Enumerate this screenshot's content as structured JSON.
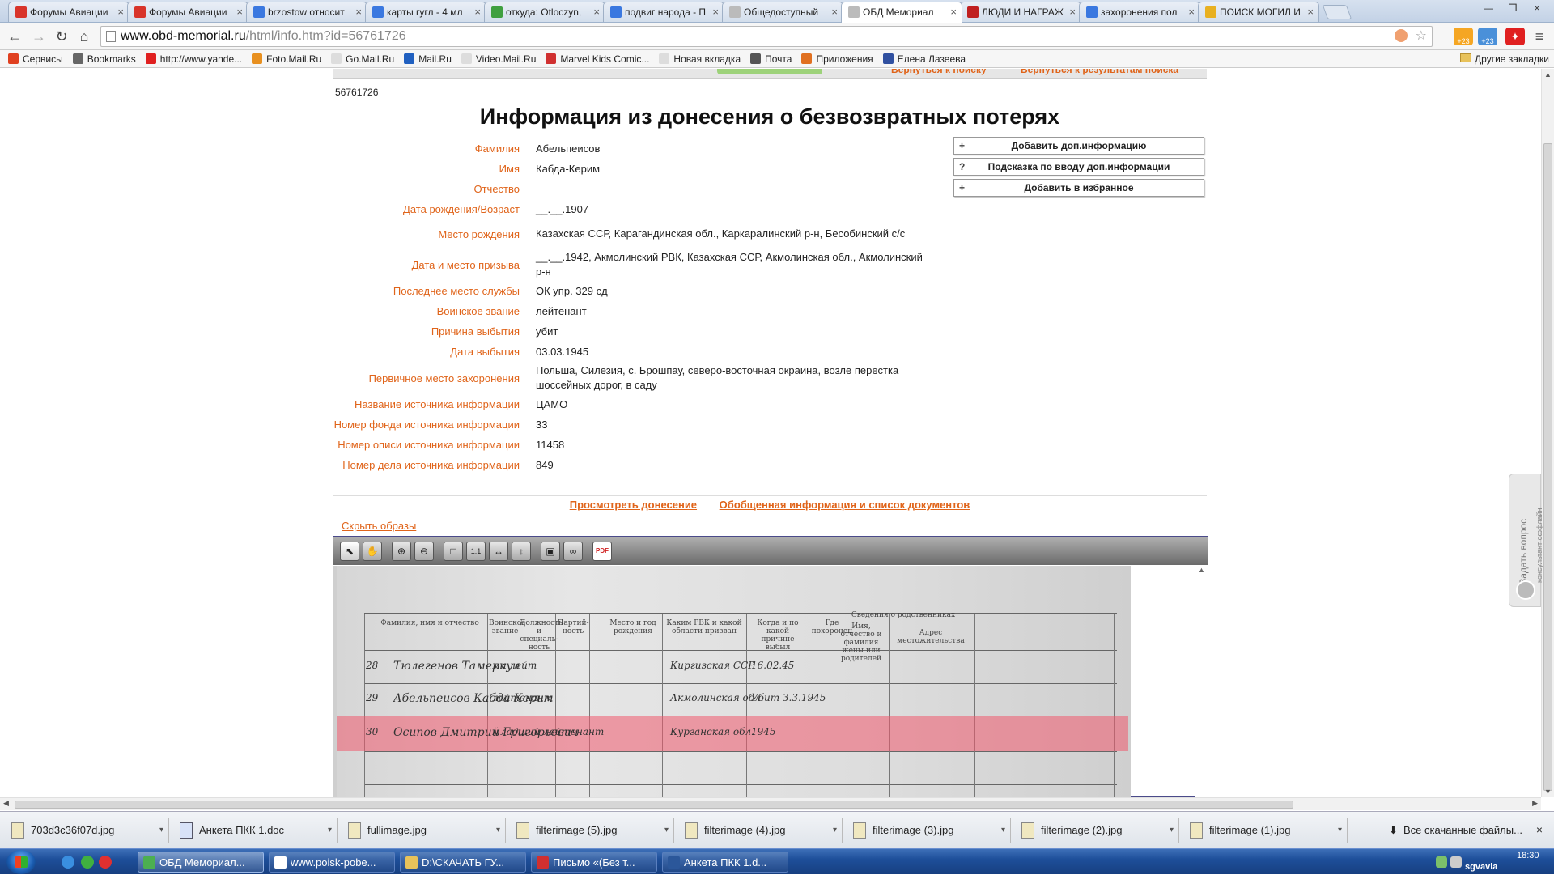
{
  "browser": {
    "tabs": [
      {
        "title": "Форумы Авиации",
        "color": "#d8342a",
        "active": false
      },
      {
        "title": "Форумы Авиации",
        "color": "#d8342a",
        "active": false
      },
      {
        "title": "brzostow относит",
        "color": "#3a78e0",
        "active": false
      },
      {
        "title": "карты гугл - 4 мл",
        "color": "#3a78e0",
        "active": false
      },
      {
        "title": "откуда: Otloczyn,",
        "color": "#40a040",
        "active": false
      },
      {
        "title": "подвиг народа - П",
        "color": "#3a78e0",
        "active": false
      },
      {
        "title": "Общедоступный",
        "color": "#bbbbbb",
        "active": false
      },
      {
        "title": "ОБД Мемориал",
        "color": "#bbbbbb",
        "active": true
      },
      {
        "title": "ЛЮДИ И НАГРАЖ",
        "color": "#c02020",
        "active": false
      },
      {
        "title": "захоронения пол",
        "color": "#3a78e0",
        "active": false
      },
      {
        "title": "ПОИСК МОГИЛ И",
        "color": "#e8b020",
        "active": false
      }
    ],
    "close_glyph": "×",
    "address": {
      "domain": "www.obd-memorial.ru",
      "path": "/html/info.htm?id=56761726"
    },
    "ext_badge": "+23",
    "bookmarks": [
      {
        "label": "Сервисы",
        "color": "#e04020"
      },
      {
        "label": "Bookmarks",
        "color": "#666666"
      },
      {
        "label": "http://www.yande...",
        "color": "#e02020"
      },
      {
        "label": "Foto.Mail.Ru",
        "color": "#e89020"
      },
      {
        "label": "Go.Mail.Ru",
        "color": "#dddddd"
      },
      {
        "label": "Mail.Ru",
        "color": "#2060c0"
      },
      {
        "label": "Video.Mail.Ru",
        "color": "#dddddd"
      },
      {
        "label": "Marvel Kids Comic...",
        "color": "#d03030"
      },
      {
        "label": "Новая вкладка",
        "color": "#dddddd"
      },
      {
        "label": "Почта",
        "color": "#555555"
      },
      {
        "label": "Приложения",
        "color": "#e07020"
      },
      {
        "label": "Елена Лазеева",
        "color": "#3050a0"
      }
    ],
    "other_bookmarks": "Другие закладки"
  },
  "page": {
    "top_links": [
      "Вернуться к поиску",
      "Вернуться к результатам поиска"
    ],
    "record_id": "56761726",
    "title": "Информация из донесения о безвозвратных потерях",
    "fields": [
      {
        "label": "Фамилия",
        "value": "Абельпеисов"
      },
      {
        "label": "Имя",
        "value": "Кабда-Керим"
      },
      {
        "label": "Отчество",
        "value": ""
      },
      {
        "label": "Дата рождения/Возраст",
        "value": "__.__.1907"
      },
      {
        "label": "Место рождения",
        "value": "Казахская ССР, Карагандинская обл., Каркаралинский р-н, Бесобинский с/с"
      },
      {
        "label": "Дата и место призыва",
        "value": "__.__.1942, Акмолинский РВК, Казахская ССР, Акмолинская обл., Акмолинский р-н"
      },
      {
        "label": "Последнее место службы",
        "value": "ОК упр. 329 сд"
      },
      {
        "label": "Воинское звание",
        "value": "лейтенант"
      },
      {
        "label": "Причина выбытия",
        "value": "убит"
      },
      {
        "label": "Дата выбытия",
        "value": "03.03.1945"
      },
      {
        "label": "Первичное место захоронения",
        "value": "Польша, Силезия, с. Брошпау, северо-восточная окраина, возле перестка шоссейных дорог, в саду"
      },
      {
        "label": "Название источника информации",
        "value": "ЦАМО"
      },
      {
        "label": "Номер фонда источника информации",
        "value": "33"
      },
      {
        "label": "Номер описи источника информации",
        "value": "11458"
      },
      {
        "label": "Номер дела источника информации",
        "value": "849"
      }
    ],
    "side_buttons": [
      {
        "icon": "+",
        "label": "Добавить доп.информацию"
      },
      {
        "icon": "?",
        "label": "Подсказка по вводу доп.информации"
      },
      {
        "icon": "+",
        "label": "Добавить в избранное"
      }
    ],
    "report_links": [
      "Просмотреть донесение",
      "Обобщенная информация и список документов"
    ],
    "hide_images": "Скрыть образы",
    "ask_widget": {
      "title": "Задать вопрос",
      "subtitle": "консультант оффлайн"
    }
  },
  "viewer": {
    "tools": [
      {
        "name": "select-tool-button",
        "glyph": "⬉",
        "active": true
      },
      {
        "name": "pan-tool-button",
        "glyph": "✋"
      },
      {
        "name": "zoom-in-button",
        "glyph": "⊕"
      },
      {
        "name": "zoom-out-button",
        "glyph": "⊖"
      },
      {
        "name": "fit-page-button",
        "glyph": "□"
      },
      {
        "name": "actual-size-button",
        "glyph": "1:1"
      },
      {
        "name": "fit-width-button",
        "glyph": "↔"
      },
      {
        "name": "fit-height-button",
        "glyph": "↕"
      },
      {
        "name": "save-image-button",
        "glyph": "▣"
      },
      {
        "name": "link-button",
        "glyph": "∞"
      },
      {
        "name": "pdf-button",
        "glyph": "PDF"
      }
    ],
    "doc_headers": [
      "Фамилия, имя и отчество",
      "Воинское звание",
      "Должность и специаль-ность",
      "Партий-ность",
      "Место и год рождения",
      "Каким РВК и какой области призван",
      "Когда и по какой причине выбыл",
      "Где похоронен",
      "Сведения о родственниках",
      "Имя, отчество и фамилия жены или родителей",
      "Адрес местожительства"
    ],
    "doc_rows": [
      {
        "num": "28",
        "name": "Тюлегенов Тамеркул",
        "rank": "мл лейт",
        "place": "Киргизская ССР",
        "date": "16.02.45"
      },
      {
        "num": "29",
        "name": "Абельпеисов Кабда-Керим",
        "rank": "лейтенант",
        "place": "Акмолинская обл.",
        "date": "Убит 3.3.1945"
      },
      {
        "num": "30",
        "name": "Осипов Дмитрий Григорьевич",
        "rank": "младший лейтенант",
        "place": "Курганская обл.",
        "date": "1945"
      }
    ]
  },
  "downloads": {
    "items": [
      {
        "file": "703d3c36f07d.jpg",
        "type": "jpg"
      },
      {
        "file": "Анкета ПКК 1.doc",
        "type": "doc"
      },
      {
        "file": "fullimage.jpg",
        "type": "jpg"
      },
      {
        "file": "filterimage (5).jpg",
        "type": "jpg"
      },
      {
        "file": "filterimage (4).jpg",
        "type": "jpg"
      },
      {
        "file": "filterimage (3).jpg",
        "type": "jpg"
      },
      {
        "file": "filterimage (2).jpg",
        "type": "jpg"
      },
      {
        "file": "filterimage (1).jpg",
        "type": "jpg"
      }
    ],
    "show_all": "Все скачанные файлы...",
    "close_glyph": "×"
  },
  "taskbar": {
    "items": [
      {
        "label": "ОБД Мемориал...",
        "color": "#4caf50",
        "active": true
      },
      {
        "label": "www.poisk-pobe...",
        "color": "#ffffff",
        "active": false
      },
      {
        "label": "D:\\СКАЧАТЬ ГУ...",
        "color": "#e8c25a",
        "active": false
      },
      {
        "label": "Письмо «(Без т...",
        "color": "#d03030",
        "active": false
      },
      {
        "label": "Анкета ПКК 1.d...",
        "color": "#2b579a",
        "active": false
      }
    ],
    "user": "sgvavia",
    "clock": "18:30"
  }
}
